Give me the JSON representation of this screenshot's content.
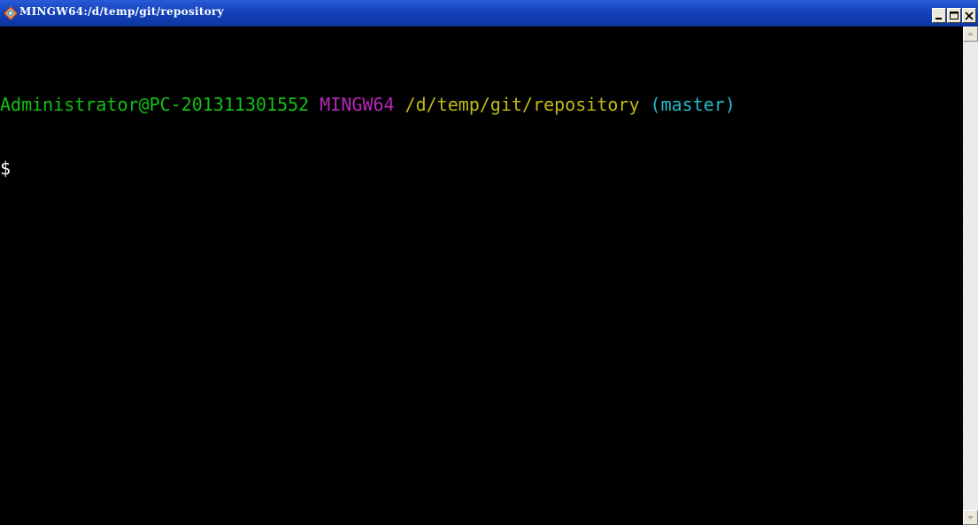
{
  "window": {
    "title": "MINGW64:/d/temp/git/repository",
    "icon": "git-diamond-icon"
  },
  "title_buttons": {
    "minimize": "minimize-icon",
    "maximize": "maximize-icon",
    "close": "close-icon"
  },
  "terminal": {
    "prompt_user": "Administrator@PC-201311301552",
    "prompt_system": "MINGW64",
    "prompt_path": "/d/temp/git/repository",
    "prompt_branch": "(master)",
    "prompt_symbol": "$"
  },
  "colors": {
    "user": "#13c113",
    "system": "#b726b7",
    "path": "#c1b913",
    "branch": "#23b9c9",
    "background": "#000000"
  },
  "scrollbar": {
    "up": "scroll-up-arrow-icon",
    "down": "scroll-down-arrow-icon"
  }
}
